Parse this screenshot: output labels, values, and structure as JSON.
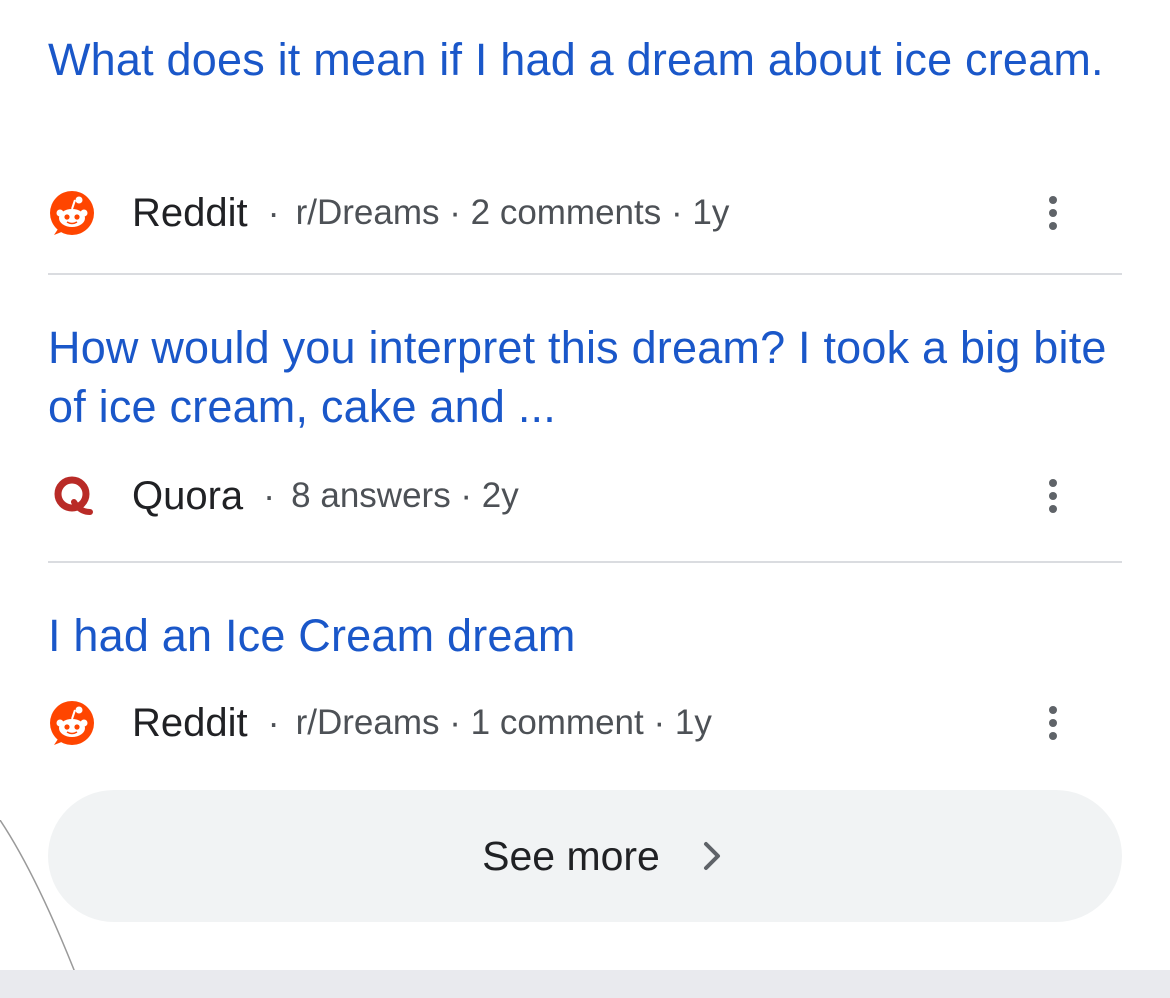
{
  "results": [
    {
      "title": "What does it mean if I had a dream about ice cream.",
      "source": "Reddit",
      "source_icon": "reddit-icon",
      "separator": "·",
      "meta": "r/Dreams · 2 comments · 1y",
      "menu_icon": "more-vert-icon"
    },
    {
      "title": "How would you interpret this dream? I took a big bite of ice cream, cake and ...",
      "source": "Quora",
      "source_icon": "quora-icon",
      "separator": "·",
      "meta": "8 answers · 2y",
      "menu_icon": "more-vert-icon"
    },
    {
      "title": "I had an Ice Cream dream",
      "source": "Reddit",
      "source_icon": "reddit-icon",
      "separator": "·",
      "meta": "r/Dreams · 1 comment · 1y",
      "menu_icon": "more-vert-icon"
    }
  ],
  "see_more": {
    "label": "See more",
    "icon": "chevron-right-icon"
  },
  "colors": {
    "link": "#1a57c9",
    "reddit": "#ff4500",
    "quora": "#b92b27",
    "button_bg": "#f1f3f4"
  }
}
